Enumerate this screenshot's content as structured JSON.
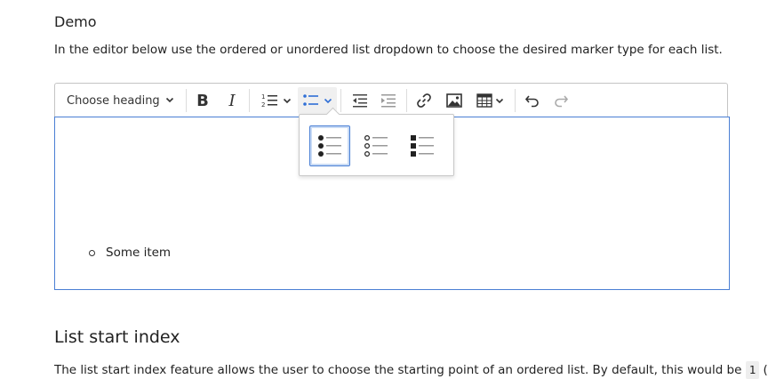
{
  "section": {
    "title": "Demo",
    "intro": "In the editor below use the ordered or unordered list dropdown to choose the desired marker type for each list."
  },
  "toolbar": {
    "heading": "Choose heading",
    "bold": "B",
    "italic": "I"
  },
  "icons": {
    "heading_dropdown": "chevron-down-icon",
    "ordered_list": "numbered-list-icon",
    "bulleted_list": "bulleted-list-icon",
    "outdent": "outdent-icon",
    "indent": "indent-icon",
    "link": "link-icon",
    "image": "image-icon",
    "table": "table-icon",
    "undo": "undo-icon",
    "redo": "redo-icon"
  },
  "list_style_dropdown": {
    "options": [
      "disc",
      "circle",
      "square"
    ],
    "selected": "disc"
  },
  "editor": {
    "items": [
      "Some item"
    ]
  },
  "next_section": {
    "title": "List start index",
    "text_before_code": "The list start index feature allows the user to choose the starting point of an ordered list. By default, this would be ",
    "code": "1",
    "text_after_code": " (or"
  },
  "colors": {
    "focus_border": "#4a7fd4",
    "toolbar_border": "#c4c4c4",
    "active_button_bg": "#f0f0f0"
  }
}
